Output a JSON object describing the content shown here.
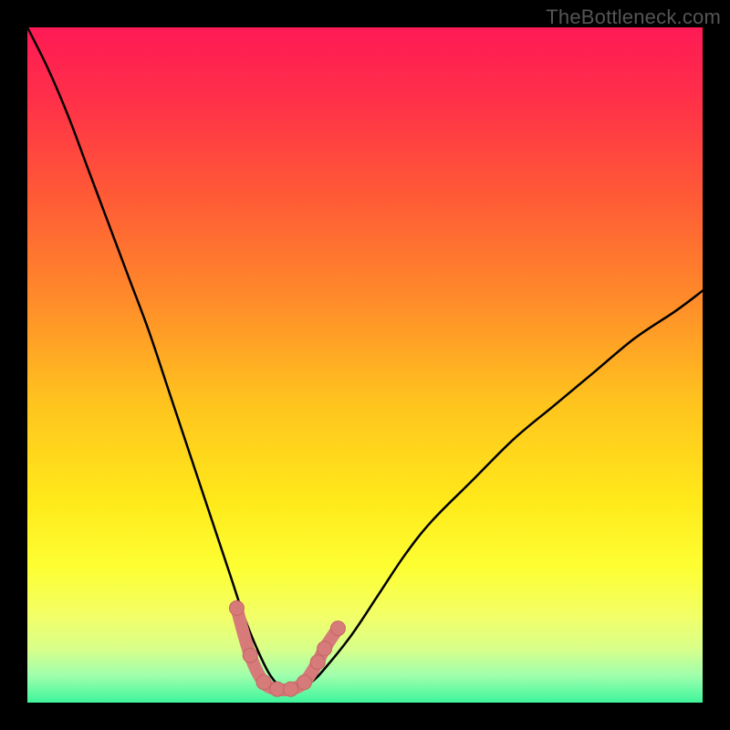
{
  "watermark": "TheBottleneck.com",
  "colors": {
    "frame": "#000000",
    "watermark": "#555555",
    "curve": "#000000",
    "marker_fill": "#d77a7a",
    "marker_stroke": "#c46565",
    "gradient_stops": [
      {
        "offset": 0.0,
        "color": "#ff1a55"
      },
      {
        "offset": 0.1,
        "color": "#ff2e4a"
      },
      {
        "offset": 0.25,
        "color": "#ff5a36"
      },
      {
        "offset": 0.4,
        "color": "#ff8a2a"
      },
      {
        "offset": 0.55,
        "color": "#ffc21f"
      },
      {
        "offset": 0.7,
        "color": "#ffe91a"
      },
      {
        "offset": 0.8,
        "color": "#fdff33"
      },
      {
        "offset": 0.87,
        "color": "#f3ff66"
      },
      {
        "offset": 0.92,
        "color": "#d9ff8a"
      },
      {
        "offset": 0.96,
        "color": "#9fffad"
      },
      {
        "offset": 1.0,
        "color": "#3ef59c"
      }
    ]
  },
  "chart_data": {
    "type": "line",
    "title": "",
    "xlabel": "",
    "ylabel": "",
    "xlim": [
      0,
      100
    ],
    "ylim": [
      0,
      100
    ],
    "series": [
      {
        "name": "bottleneck-curve",
        "x": [
          0,
          3,
          6,
          9,
          12,
          15,
          18,
          21,
          24,
          27,
          30,
          32,
          34,
          36,
          38,
          40,
          42,
          44,
          48,
          52,
          56,
          60,
          66,
          72,
          78,
          84,
          90,
          96,
          100
        ],
        "y": [
          100,
          94,
          87,
          79,
          71,
          63,
          55,
          46,
          37,
          28,
          19,
          13,
          8,
          4,
          2,
          2,
          3,
          5,
          10,
          16,
          22,
          27,
          33,
          39,
          44,
          49,
          54,
          58,
          61
        ]
      }
    ],
    "markers": {
      "name": "valley-markers",
      "points": [
        {
          "x": 31,
          "y": 14
        },
        {
          "x": 33,
          "y": 7
        },
        {
          "x": 35,
          "y": 3
        },
        {
          "x": 37,
          "y": 2
        },
        {
          "x": 39,
          "y": 2
        },
        {
          "x": 41,
          "y": 3
        },
        {
          "x": 43,
          "y": 6
        },
        {
          "x": 44,
          "y": 8
        },
        {
          "x": 46,
          "y": 11
        }
      ],
      "radius": 8
    }
  }
}
